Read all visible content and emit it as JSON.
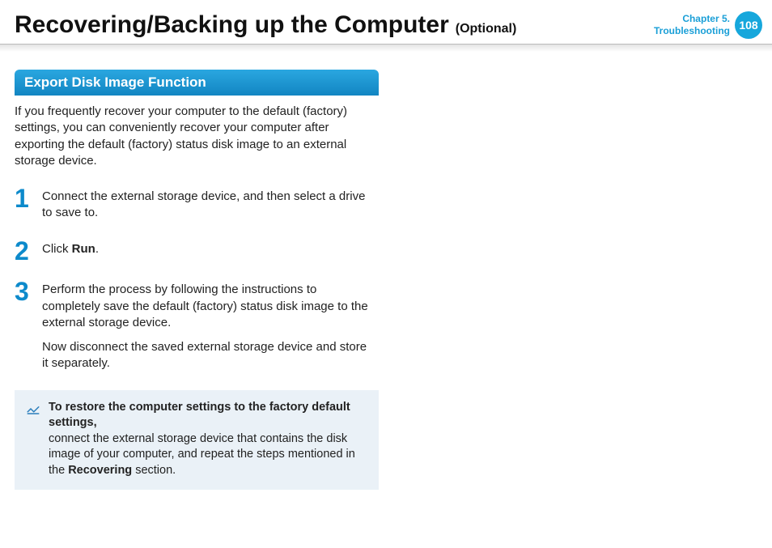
{
  "header": {
    "title": "Recovering/Backing up the Computer",
    "subtitle": "(Optional)",
    "chapter_line1": "Chapter 5.",
    "chapter_line2": "Troubleshooting",
    "page_number": "108"
  },
  "section": {
    "heading": "Export Disk Image Function",
    "intro": "If you frequently recover your computer to the default (factory) settings, you can conveniently recover your computer after exporting the default (factory) status disk image to an external storage device."
  },
  "steps": [
    {
      "num": "1",
      "body_html": "Connect the external storage device, and then select a drive to save to."
    },
    {
      "num": "2",
      "body_html": "Click <b>Run</b>."
    },
    {
      "num": "3",
      "body_html": "Perform the process by following the instructions to completely save the default (factory) status disk image to the external storage device.",
      "body_html2": "Now disconnect the saved external storage device and store it separately."
    }
  ],
  "note": {
    "title_html": "To restore the computer settings to the factory default settings,",
    "body_html": "connect the external storage device that contains the disk image of your computer, and repeat the steps mentioned in the <b>Recovering</b> section."
  }
}
